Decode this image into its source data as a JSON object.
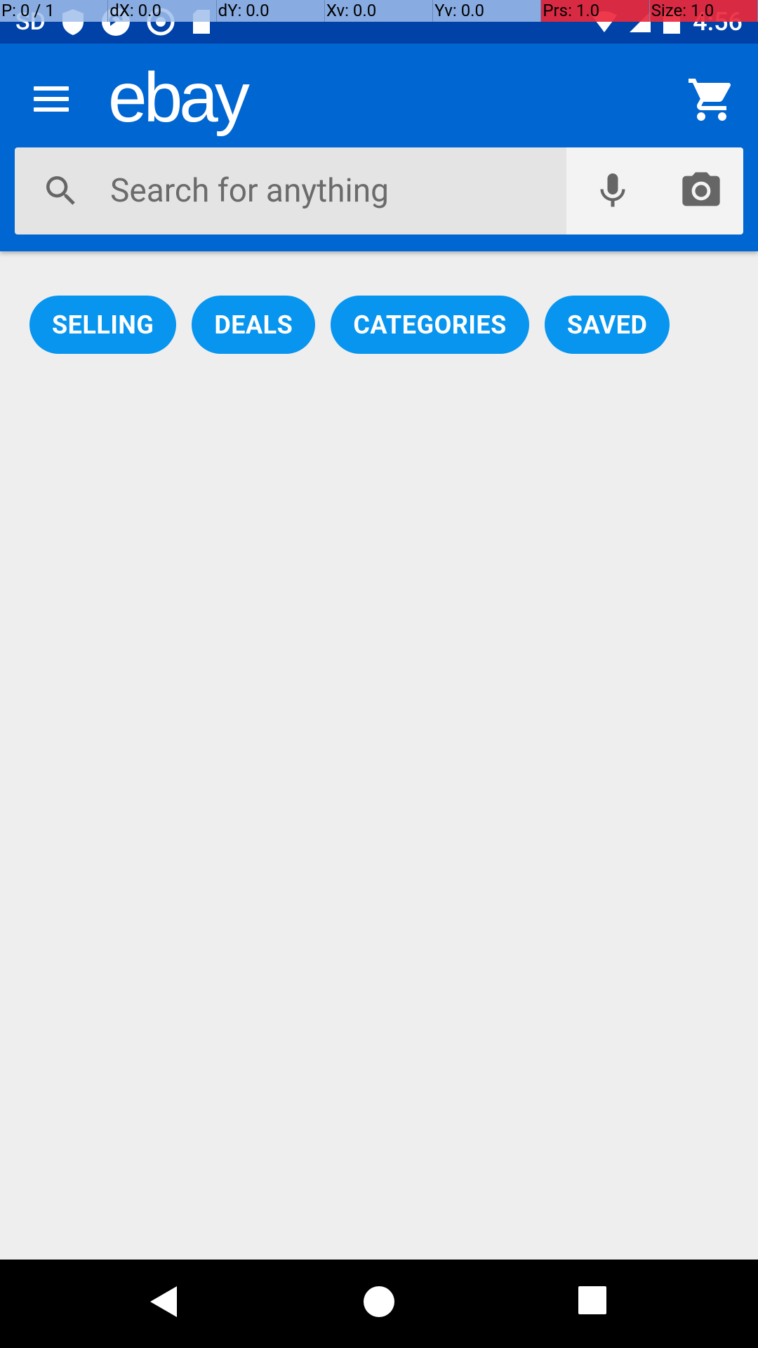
{
  "status_bar": {
    "left_label": "SD",
    "time": "4:56",
    "icons": [
      "sd-card-icon",
      "shield-icon",
      "sync-icon",
      "circle-icon",
      "sim-card-icon"
    ],
    "right_icons": [
      "wifi-icon",
      "signal-icon",
      "battery-icon"
    ]
  },
  "debug_overlay": {
    "pointer": "P: 0 / 1",
    "dx": "dX: 0.0",
    "dy": "dY: 0.0",
    "xv": "Xv: 0.0",
    "yv": "Yv: 0.0",
    "prs": "Prs: 1.0",
    "size": "Size: 1.0"
  },
  "header": {
    "logo": "ebay",
    "menu_icon": "hamburger-menu-icon",
    "cart_icon": "shopping-cart-icon"
  },
  "search": {
    "placeholder": "Search for anything",
    "search_icon": "search-icon",
    "mic_icon": "microphone-icon",
    "camera_icon": "camera-icon"
  },
  "pills": [
    {
      "label": "SELLING"
    },
    {
      "label": "DEALS"
    },
    {
      "label": "CATEGORIES"
    },
    {
      "label": "SAVED"
    }
  ],
  "nav_bar": {
    "back_icon": "back-triangle-icon",
    "home_icon": "home-circle-icon",
    "recents_icon": "recents-square-icon"
  },
  "colors": {
    "status_bar": "#0042a8",
    "app_bar": "#0066d1",
    "pill": "#0795ef",
    "background": "#eeeeee",
    "nav_bar": "#000000"
  }
}
